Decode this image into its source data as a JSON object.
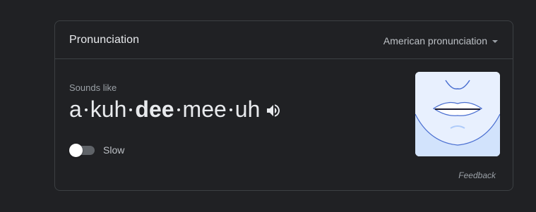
{
  "card": {
    "title": "Pronunciation",
    "accent_selector": {
      "label": "American pronunciation",
      "icon": "arrow-drop-down-icon"
    }
  },
  "sounds_like": {
    "label": "Sounds like",
    "syllables": [
      {
        "text": "a",
        "stressed": false
      },
      {
        "text": "kuh",
        "stressed": false
      },
      {
        "text": "dee",
        "stressed": true
      },
      {
        "text": "mee",
        "stressed": false
      },
      {
        "text": "uh",
        "stressed": false
      }
    ],
    "play_icon": "volume-up-icon"
  },
  "slow_toggle": {
    "label": "Slow",
    "on": false
  },
  "mouth_illustration": {
    "icon": "mouth-diagram-icon"
  },
  "feedback": {
    "label": "Feedback"
  },
  "colors": {
    "background": "#202124",
    "border": "#3c4043",
    "text_primary": "#e8eaed",
    "text_secondary": "#9aa0a6",
    "illustration_bg": "#e8f0fe",
    "illustration_line": "#4a6fd1"
  }
}
